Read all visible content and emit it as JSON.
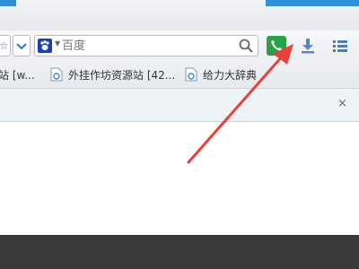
{
  "search": {
    "engine_icon": "baidu-paw-icon",
    "placeholder": "百度"
  },
  "toolbar": {
    "address_stub_text": "☆",
    "phone_icon": "phone-icon",
    "download_icon": "download-icon",
    "menu_icon": "list-menu-icon"
  },
  "bookmarks": [
    {
      "label": "站 [w..."
    },
    {
      "label": "外挂作坊资源站 [42..."
    },
    {
      "label": "给力大辞典"
    }
  ],
  "tabstrip": {
    "close_label": "×"
  },
  "colors": {
    "accent_blue": "#2f8fd8",
    "phone_green": "#2aa14a",
    "arrow_red": "#e8413a"
  }
}
